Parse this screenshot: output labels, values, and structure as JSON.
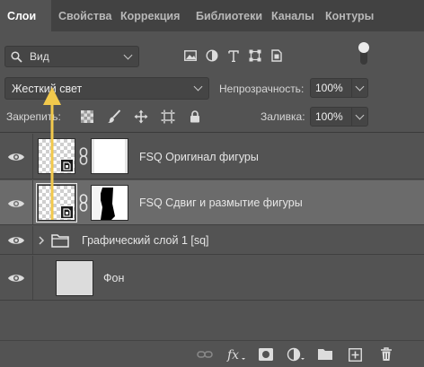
{
  "tabs": [
    "Слои",
    "Свойства",
    "Коррекция",
    "Библиотеки",
    "Каналы",
    "Контуры"
  ],
  "filter": {
    "label": "Вид"
  },
  "blend_mode": {
    "value": "Жесткий свет"
  },
  "opacity": {
    "label": "Непрозрачность:",
    "value": "100%"
  },
  "lock": {
    "label": "Закрепить:"
  },
  "fill": {
    "label": "Заливка:",
    "value": "100%"
  },
  "layers": [
    {
      "name": "FSQ Оригинал фигуры",
      "selected": false
    },
    {
      "name": "FSQ Сдвиг и размытие фигуры",
      "selected": true
    },
    {
      "name": "Графический слой 1 [sq]",
      "selected": false,
      "type": "group"
    },
    {
      "name": "Фон",
      "selected": false
    }
  ],
  "colors": {
    "panel": "#535353",
    "tabbar": "#424242",
    "selected_layer": "#6b6b6b",
    "annotation_arrow": "#f2c94c"
  }
}
